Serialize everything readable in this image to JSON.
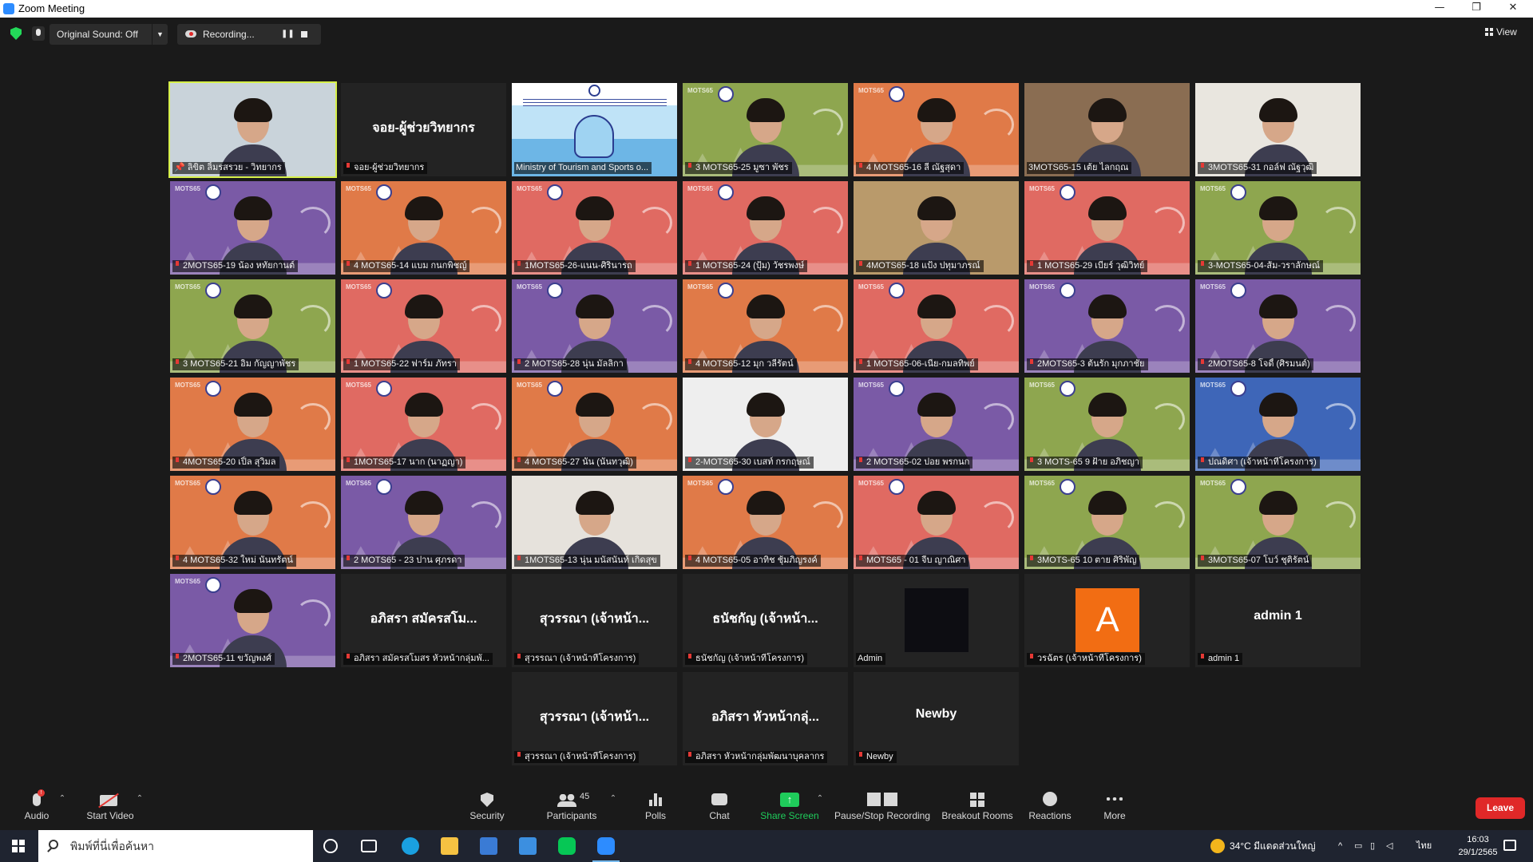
{
  "window": {
    "title": "Zoom Meeting",
    "minimize": "—",
    "restore": "❐",
    "close": "✕"
  },
  "topbar": {
    "original_sound": "Original Sound: Off",
    "recording": "Recording...",
    "view": "View"
  },
  "tiles": [
    {
      "caption": "ลิขิต ลิ้มรสรวย - วิทยากร",
      "kind": "video",
      "bg": "#c9d3da",
      "speaker": true
    },
    {
      "caption": "จอย-ผู้ช่วยวิทยากร",
      "kind": "name",
      "display_name": "จอย-ผู้ช่วยวิทยากร"
    },
    {
      "caption": "Ministry of Tourism and Sports o...",
      "kind": "poster"
    },
    {
      "caption": "3 MOTS65-25 มูซา พัชร",
      "kind": "vbg",
      "bg": "#8ea64f"
    },
    {
      "caption": "4 MOTS65-16 ลี ณัฐสุดา",
      "kind": "vbg",
      "bg": "#e07a48"
    },
    {
      "caption": "3MOTS65-15 เต้ย ไลกฤณ",
      "kind": "video",
      "bg": "#8a6d52"
    },
    {
      "caption": "3MOTS65-31 กอล์ฟ ณัฐวุฒิ",
      "kind": "video",
      "bg": "#e9e6df"
    },
    {
      "caption": "2MOTS65-19 น้อง หทัยกานต์",
      "kind": "vbg",
      "bg": "#7a5aa6"
    },
    {
      "caption": "4 MOTS65-14 แบม กนกพิชญ์",
      "kind": "vbg",
      "bg": "#e07a48"
    },
    {
      "caption": "1MOTS65-26-แนน-ศิรินารถ",
      "kind": "vbg",
      "bg": "#e06a62"
    },
    {
      "caption": "1 MOTS65-24 (ปุ้ม) วัชรพงษ์",
      "kind": "vbg",
      "bg": "#e06a62"
    },
    {
      "caption": "4MOTS65-18 แป้ง ปทุมาภรณ์",
      "kind": "video",
      "bg": "#b99a6b"
    },
    {
      "caption": "1 MOTS65-29 เบียร์ วุฒิวิทย์",
      "kind": "vbg",
      "bg": "#e06a62"
    },
    {
      "caption": "3-MOTS65-04-ส้ม-วราลักษณ์",
      "kind": "vbg",
      "bg": "#8ea64f"
    },
    {
      "caption": "3 MOTS65-21 อิม กัญญาพัชร",
      "kind": "vbg",
      "bg": "#8ea64f"
    },
    {
      "caption": "1 MOTS65-22 ฟาร์ม ภัทรา",
      "kind": "vbg",
      "bg": "#e06a62"
    },
    {
      "caption": "2 MOTS65-28 นุ่น มัลลิกา",
      "kind": "vbg",
      "bg": "#7a5aa6"
    },
    {
      "caption": "4 MOTS65-12 มุก วลีรัตน์",
      "kind": "vbg",
      "bg": "#e07a48"
    },
    {
      "caption": "1 MOTS65-06-เนีย-กมลทิพย์",
      "kind": "vbg",
      "bg": "#e06a62"
    },
    {
      "caption": "2MOTS65-3 ต้นรัก มุกภาชัย",
      "kind": "vbg",
      "bg": "#7a5aa6"
    },
    {
      "caption": "2MOTS65-8 โจดี้ (ศิรมนต์)",
      "kind": "vbg",
      "bg": "#7a5aa6"
    },
    {
      "caption": "4MOTS65-20 เปิ้ล สุวิมล",
      "kind": "vbg",
      "bg": "#e07a48"
    },
    {
      "caption": "1MOTS65-17 นาก (นาฏญา)",
      "kind": "vbg",
      "bg": "#e06a62"
    },
    {
      "caption": "4 MOTS65-27 นัน (นันทวุฒิ)",
      "kind": "vbg",
      "bg": "#e07a48"
    },
    {
      "caption": "2-MOTS65-30 เบสท์ กรกฤษณ์",
      "kind": "video",
      "bg": "#eeeeee"
    },
    {
      "caption": "2 MOTS65-02 ปอย พรกนก",
      "kind": "vbg",
      "bg": "#7a5aa6"
    },
    {
      "caption": "3 MOTS-65 9 ฝ้าย อภิชญา",
      "kind": "vbg",
      "bg": "#8ea64f"
    },
    {
      "caption": "ปณดิศา (เจ้าหน้าที่โครงการ)",
      "kind": "vbg",
      "bg": "#3e66b8"
    },
    {
      "caption": "4 MOTS65-32 ใหม่ นันทรัตน์",
      "kind": "vbg",
      "bg": "#e07a48"
    },
    {
      "caption": "2 MOTS65 - 23 ปาน ศุภรดา",
      "kind": "vbg",
      "bg": "#7a5aa6"
    },
    {
      "caption": "1MOTS65-13 นุ่น มนัสนันท์ เกิดสุข",
      "kind": "video",
      "bg": "#e6e2dc"
    },
    {
      "caption": "4 MOTS65-05 อาทิช ชุ้มภิญรงค์",
      "kind": "vbg",
      "bg": "#e07a48"
    },
    {
      "caption": "MOTS65 - 01 จีบ ญาณิศา",
      "kind": "vbg",
      "bg": "#e06a62"
    },
    {
      "caption": "3MOTS-65 10 ตาย ศิริพัญ",
      "kind": "vbg",
      "bg": "#8ea64f"
    },
    {
      "caption": "3MOTS65-07 โบว์ ชุติรัตน์",
      "kind": "vbg",
      "bg": "#8ea64f"
    },
    {
      "caption": "2MOTS65-11 ขวัญพงศ์",
      "kind": "vbg",
      "bg": "#7a5aa6"
    },
    {
      "caption": "อภิสรา สมัครสโมสร หัวหน้ากลุ่มพั...",
      "kind": "name",
      "display_name": "อภิสรา สมัครสโม..."
    },
    {
      "caption": "สุวรรณา (เจ้าหน้าที่โครงการ)",
      "kind": "name",
      "display_name": "สุวรรณา (เจ้าหน้า..."
    },
    {
      "caption": "ธนัชกัญ (เจ้าหน้าที่โครงการ)",
      "kind": "name",
      "display_name": "ธนัชกัญ (เจ้าหน้า..."
    },
    {
      "caption": "Admin",
      "kind": "dark"
    },
    {
      "caption": "วรฉัตร (เจ้าหน้าที่โครงการ)",
      "kind": "avatar",
      "avatar_letter": "A"
    },
    {
      "caption": "admin 1",
      "kind": "name",
      "display_name": "admin 1"
    },
    {
      "caption": "สุวรรณา (เจ้าหน้าที่โครงการ)",
      "kind": "name",
      "display_name": "สุวรรณา (เจ้าหน้า..."
    },
    {
      "caption": "อภิสรา หัวหน้ากลุ่มพัฒนาบุคลากร",
      "kind": "name",
      "display_name": "อภิสรา หัวหน้ากลุ่..."
    },
    {
      "caption": "Newby",
      "kind": "name",
      "display_name": "Newby"
    }
  ],
  "bg_stripe_text": "MOTS65",
  "poster_tile_bg_word": "MOTS 65",
  "toolbar": {
    "audio": "Audio",
    "start_video": "Start Video",
    "security": "Security",
    "participants": "Participants",
    "participants_count": "45",
    "polls": "Polls",
    "chat": "Chat",
    "share_screen": "Share Screen",
    "pause_stop_recording": "Pause/Stop Recording",
    "breakout_rooms": "Breakout Rooms",
    "reactions": "Reactions",
    "more": "More",
    "leave": "Leave",
    "alert_mark": "!"
  },
  "taskbar": {
    "search_placeholder": "พิมพ์ที่นี่เพื่อค้นหา",
    "weather": "34°C มีแดดส่วนใหญ่",
    "language": "ไทย",
    "time": "16:03",
    "date": "29/1/2565"
  },
  "colors": {
    "speaker_outline": "#d6f04a",
    "leave": "#e02828",
    "share_screen": "#1fcc5b",
    "mute_icon": "#e53935",
    "avatar_orange": "#f26d13"
  }
}
